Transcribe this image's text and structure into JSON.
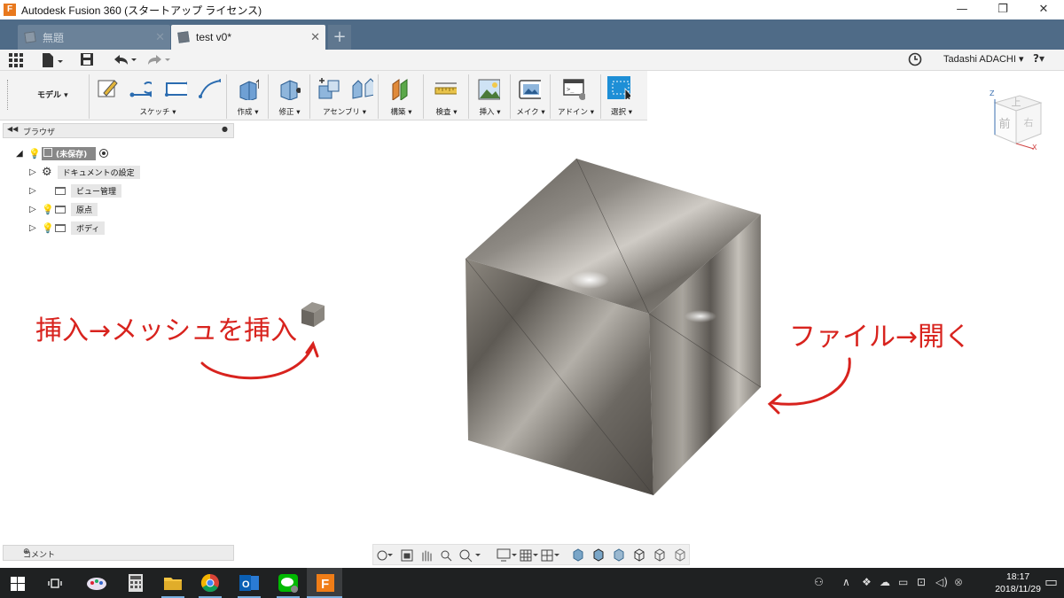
{
  "window": {
    "title": "Autodesk Fusion 360 (スタートアップ ライセンス)",
    "app_icon_letter": "F",
    "minimize": "—",
    "restore": "❐",
    "close": "✕"
  },
  "tabs": [
    {
      "label": "無題",
      "close": "✕"
    },
    {
      "label": "test v0*",
      "close": "✕"
    }
  ],
  "tab_add": "+",
  "user": {
    "name": "Tadashi ADACHI ▾",
    "help": "?▾"
  },
  "toolbar": {
    "workspace": "モデル ▾",
    "groups": [
      "スケッチ ▾",
      "作成 ▾",
      "修正 ▾",
      "アセンブリ ▾",
      "構築 ▾",
      "検査 ▾",
      "挿入 ▾",
      "メイク ▾",
      "アドイン ▾",
      "選択 ▾"
    ]
  },
  "browser": {
    "title": "ブラウザ",
    "root": "(未保存)",
    "nodes": [
      "ドキュメントの設定",
      "ビュー管理",
      "原点",
      "ボディ"
    ]
  },
  "comments": {
    "label": "コメント"
  },
  "viewcube": {
    "top": "上",
    "front": "前",
    "right": "右",
    "z": "Z",
    "x": "X"
  },
  "annotations": {
    "left": "挿入→メッシュを挿入",
    "right": "ファイル→開く"
  },
  "clock": {
    "time": "18:17",
    "date": "2018/11/29"
  },
  "colors": {
    "annotation": "#d8231e",
    "tabbar": "#4f6b87",
    "select_active": "#1e8fd6"
  }
}
